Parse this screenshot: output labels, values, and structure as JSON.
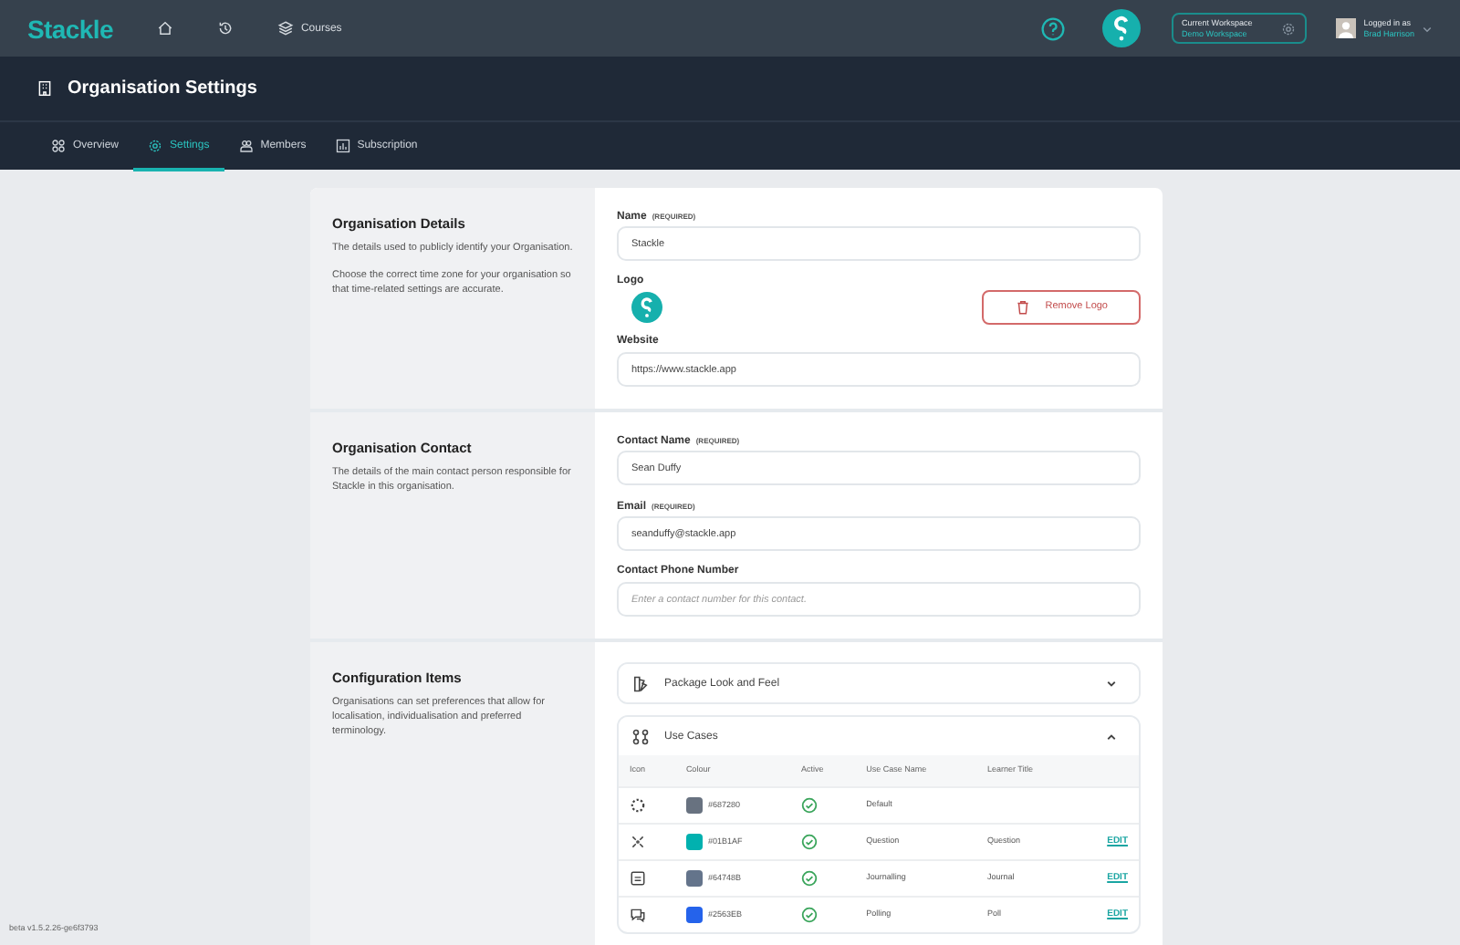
{
  "topbar": {
    "logo": "Stackle",
    "nav": [
      {
        "kind": "home"
      },
      {
        "kind": "history"
      },
      {
        "kind": "courses",
        "label": "Courses"
      }
    ],
    "workspace": {
      "label": "Current Workspace",
      "name": "Demo Workspace"
    },
    "user": {
      "label": "Logged in as",
      "name": "Brad Harrison"
    }
  },
  "page": {
    "title": "Organisation Settings"
  },
  "tabs": [
    {
      "label": "Overview",
      "kind": "overview",
      "selected": false
    },
    {
      "label": "Settings",
      "kind": "settings",
      "selected": true
    },
    {
      "label": "Members",
      "kind": "members",
      "selected": false
    },
    {
      "label": "Subscription",
      "kind": "subscription",
      "selected": false
    }
  ],
  "sections": [
    {
      "title": "Organisation Details",
      "paragraphs": [
        "The details used to publicly identify your Organisation.",
        "Choose the correct time zone for your organisation so that time-related settings are accurate."
      ],
      "fields": [
        {
          "kind": "text",
          "label": "Name",
          "required": "(REQUIRED)",
          "value": "Stackle"
        },
        {
          "kind": "logo",
          "label": "Logo",
          "button": "Remove Logo"
        },
        {
          "kind": "text",
          "label": "Website",
          "value": "https://www.stackle.app"
        }
      ]
    },
    {
      "title": "Organisation Contact",
      "paragraphs": [
        "The details of the main contact person responsible for Stackle in this organisation."
      ],
      "fields": [
        {
          "kind": "text",
          "label": "Contact Name",
          "required": "(REQUIRED)",
          "value": "Sean Duffy"
        },
        {
          "kind": "text",
          "label": "Email",
          "required": "(REQUIRED)",
          "value": "seanduffy@stackle.app"
        },
        {
          "kind": "text",
          "label": "Contact Phone Number",
          "placeholder": "Enter a contact number for this contact."
        }
      ]
    },
    {
      "title": "Configuration Items",
      "paragraphs": [
        "Organisations can set preferences that allow for localisation, individualisation and preferred terminology."
      ],
      "accordions": [
        {
          "kind": "palette",
          "title": "Package Look and Feel",
          "expanded": false
        },
        {
          "kind": "usecases",
          "title": "Use Cases",
          "expanded": true,
          "table": {
            "columns": [
              "Icon",
              "Colour",
              "Active",
              "Use Case Name",
              "Learner Title"
            ],
            "rows": [
              {
                "color": "#687280",
                "colour": "#687280",
                "active": true,
                "name": "Default"
              },
              {
                "color": "#01B1AF",
                "colour": "#01B1AF",
                "active": true,
                "name": "Question",
                "learner_title": "Question",
                "action": "EDIT"
              },
              {
                "color": "#64748B",
                "colour": "#64748B",
                "active": true,
                "name": "Journalling",
                "learner_title": "Journal",
                "action": "EDIT"
              },
              {
                "color": "#2563EB",
                "colour": "#2563EB",
                "active": true,
                "name": "Polling",
                "learner_title": "Poll",
                "action": "EDIT"
              }
            ]
          }
        }
      ]
    }
  ],
  "version": "beta v1.5.2.26-ge6f3793"
}
